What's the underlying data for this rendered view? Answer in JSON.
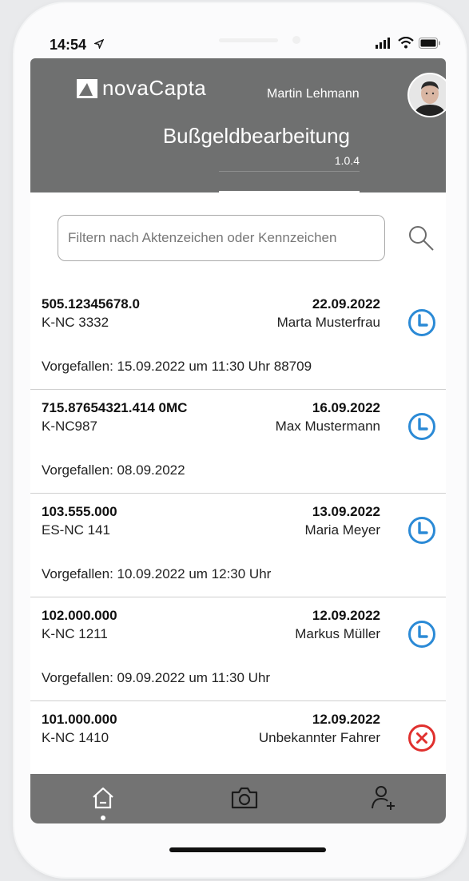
{
  "status_bar": {
    "time": "14:54"
  },
  "header": {
    "logo_text": "novaCapta",
    "user_name": "Martin Lehmann",
    "app_title": "Bußgeldbearbeitung",
    "version": "1.0.4"
  },
  "search": {
    "placeholder": "Filtern nach Aktenzeichen oder Kennzeichen",
    "value": ""
  },
  "cases": [
    {
      "aktenzeichen": "505.12345678.0",
      "date": "22.09.2022",
      "plate": "K-NC 3332",
      "person": "Marta Musterfrau",
      "detail": "Vorgefallen: 15.09.2022 um 11:30 Uhr 88709",
      "status": "clock-icon"
    },
    {
      "aktenzeichen": "715.87654321.414 0MC",
      "date": "16.09.2022",
      "plate": "K-NC987",
      "person": "Max Mustermann",
      "detail": "Vorgefallen: 08.09.2022",
      "status": "clock-icon"
    },
    {
      "aktenzeichen": "103.555.000",
      "date": "13.09.2022",
      "plate": "ES-NC 141",
      "person": "Maria Meyer",
      "detail": "Vorgefallen: 10.09.2022 um 12:30 Uhr",
      "status": "clock-icon"
    },
    {
      "aktenzeichen": "102.000.000",
      "date": "12.09.2022",
      "plate": "K-NC 1211",
      "person": "Markus Müller",
      "detail": "Vorgefallen: 09.09.2022 um 11:30 Uhr",
      "status": "clock-icon"
    },
    {
      "aktenzeichen": "101.000.000",
      "date": "12.09.2022",
      "plate": "K-NC 1410",
      "person": "Unbekannter Fahrer",
      "detail": "",
      "status": "x-circle-icon"
    }
  ],
  "nav": {
    "items": [
      "home-icon",
      "camera-icon",
      "add-person-icon"
    ],
    "active": "home-icon"
  },
  "colors": {
    "header_bg": "#6f7070",
    "nav_bg": "#737373",
    "pending_blue": "#2b8ad6",
    "rejected_red": "#e0302e"
  }
}
